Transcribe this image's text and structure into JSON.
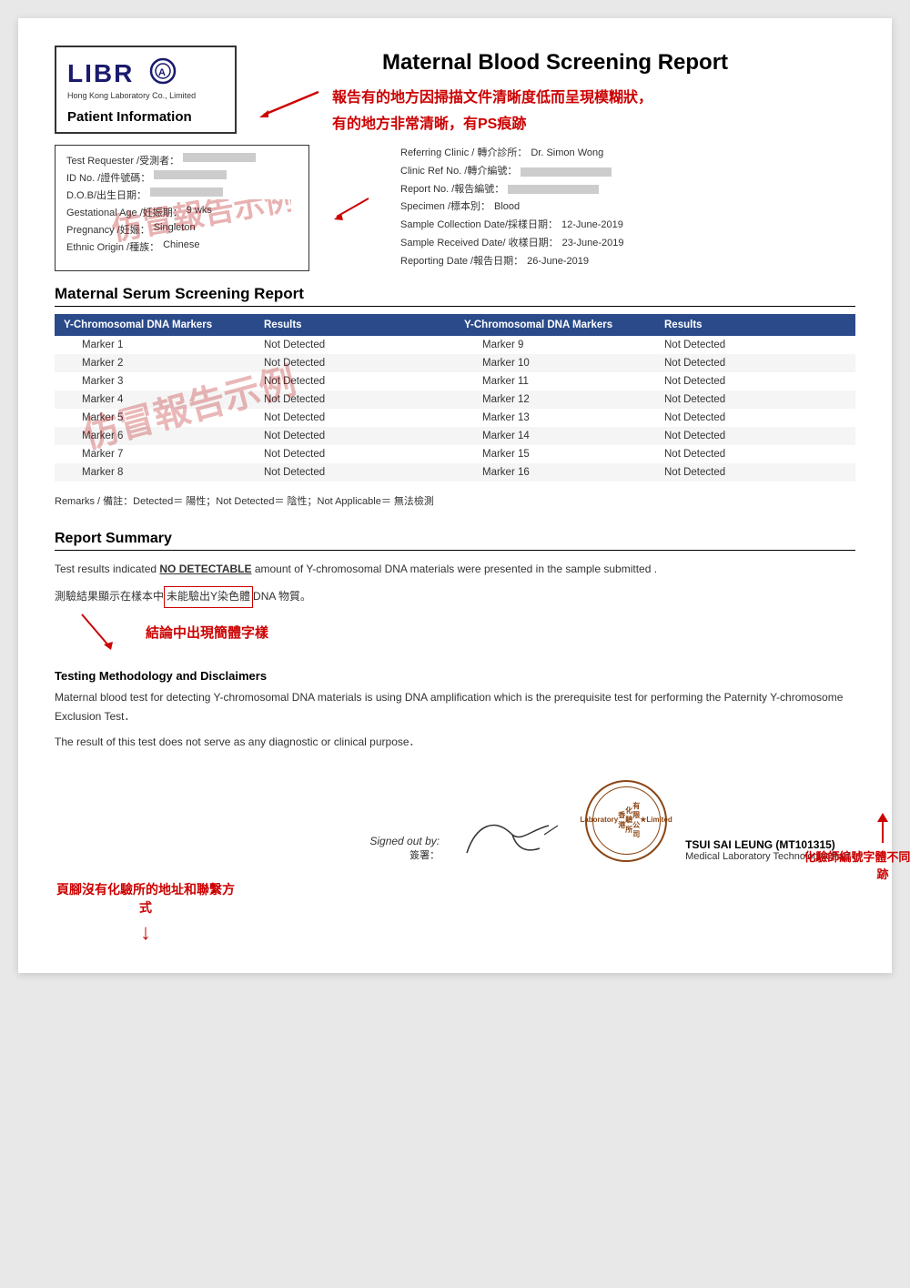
{
  "page": {
    "background": "#e8e8e8"
  },
  "header": {
    "logo_text": "LIBRA",
    "company_name": "Hong Kong Laboratory Co., Limited",
    "main_title": "Maternal Blood Screening Report",
    "annotation_line1": "報告有的地方因掃描文件清晰度低而呈現模糊狀，",
    "annotation_line2": "有的地方非常清晰，有PS痕跡",
    "patient_info_header": "Patient Information"
  },
  "patient_info": {
    "left": {
      "test_requester_label": "Test Requester /受測者：",
      "id_label": "ID No. /證件號碼：",
      "dob_label": "D.O.B/出生日期：",
      "gestational_label": "Gestational Age /妊娠期：",
      "gestational_value": "9 wks",
      "pregnancy_label": "Pregnancy /妊娠：",
      "pregnancy_value": "Singleton",
      "ethnic_label": "Ethnic Origin /種族：",
      "ethnic_value": "Chinese"
    },
    "right": {
      "referring_clinic_label": "Referring Clinic / 轉介診所：",
      "referring_clinic_value": "Dr. Simon Wong",
      "clinic_ref_label": "Clinic Ref No. /轉介編號：",
      "report_no_label": "Report No. /報告編號：",
      "specimen_label": "Specimen /標本別：",
      "specimen_value": "Blood",
      "collection_date_label": "Sample Collection Date/採樣日期：",
      "collection_date_value": "12-June-2019",
      "received_date_label": "Sample Received Date/ 收樣日期：",
      "received_date_value": "23-June-2019",
      "reporting_date_label": "Reporting Date /報告日期：",
      "reporting_date_value": "26-June-2019"
    },
    "stamp_text": "仿冒報告示例"
  },
  "serum_report": {
    "title": "Maternal Serum Screening  Report",
    "table": {
      "col1_header": "Y-Chromosomal DNA Markers",
      "col2_header": "Results",
      "col3_header": "Y-Chromosomal  DNA Markers",
      "col4_header": "Results",
      "rows": [
        {
          "marker_left": "Marker 1",
          "result_left": "Not Detected",
          "marker_right": "Marker 9",
          "result_right": "Not Detected"
        },
        {
          "marker_left": "Marker 2",
          "result_left": "Not Detected",
          "marker_right": "Marker 10",
          "result_right": "Not Detected"
        },
        {
          "marker_left": "Marker 3",
          "result_left": "Not Detected",
          "marker_right": "Marker 11",
          "result_right": "Not Detected"
        },
        {
          "marker_left": "Marker 4",
          "result_left": "Not Detected",
          "marker_right": "Marker 12",
          "result_right": "Not Detected"
        },
        {
          "marker_left": "Marker 5",
          "result_left": "Not Detected",
          "marker_right": "Marker 13",
          "result_right": "Not Detected"
        },
        {
          "marker_left": "Marker 6",
          "result_left": "Not Detected",
          "marker_right": "Marker 14",
          "result_right": "Not Detected"
        },
        {
          "marker_left": "Marker 7",
          "result_left": "Not Detected",
          "marker_right": "Marker 15",
          "result_right": "Not Detected"
        },
        {
          "marker_left": "Marker 8",
          "result_left": "Not Detected",
          "marker_right": "Marker 16",
          "result_right": "Not Detected"
        }
      ]
    },
    "remarks": "Remarks /  備註：Detected＝  陽性；Not Detected＝  陰性；Not Applicable＝  無法檢測",
    "stamp_text": "仿冒報告示例"
  },
  "report_summary": {
    "title": "Report Summary",
    "text_part1": "Test results indicated ",
    "text_bold": "NO DETECTABLE",
    "text_part2": " amount of Y-chromosomal DNA materials were presented in the sample submitted .",
    "chinese_text_before": "測驗結果顯示在樣本中",
    "chinese_text_highlighted": "未能驗出Y染色體",
    "chinese_text_after": " DNA 物質。",
    "annotation": "結論中出現簡體字樣"
  },
  "methodology": {
    "title": "Testing  Methodology and Disclaimers",
    "text1": "Maternal blood test for detecting Y-chromosomal DNA materials is using DNA amplification which is the prerequisite test for performing the Paternity Y-chromosome Exclusion Test．",
    "text2": "The result of this test does not serve as any diagnostic or clinical purpose．"
  },
  "signature": {
    "signed_out_by_label": "Signed out by:",
    "qianzheng_label": "簽署：",
    "stamp_text_line1": "香港",
    "stamp_text_line2": "化驗所",
    "stamp_text_line3": "有限公司",
    "name": "TSUI SAI LEUNG (MT101315)",
    "title": "Medical Laboratory Technologist  Part I"
  },
  "bottom_annotations": {
    "left_text": "頁腳沒有化驗所的地址和聯繫方式",
    "right_text": "化驗師編號字體不同，有PS痕跡"
  }
}
